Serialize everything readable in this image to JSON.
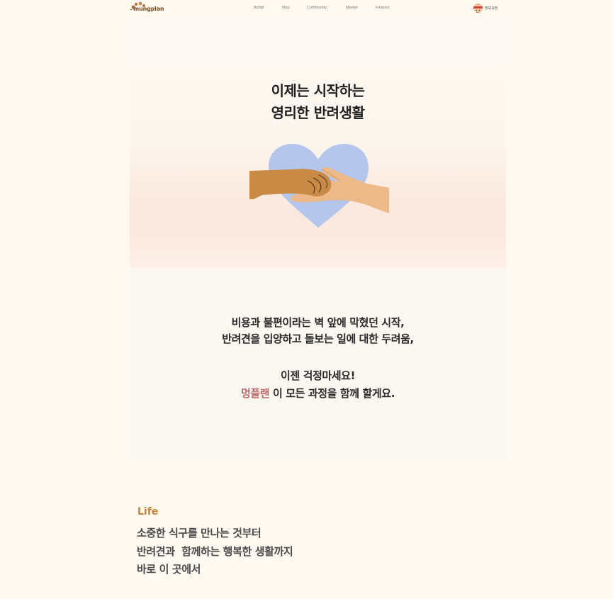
{
  "header": {
    "logo_text": "mungplan",
    "nav": [
      {
        "label": "Adopt"
      },
      {
        "label": "Map"
      },
      {
        "label": "Community"
      },
      {
        "label": "Market"
      },
      {
        "label": "Finance"
      }
    ],
    "user_name": "정보요정"
  },
  "hero": {
    "title_line1": "이제는 시작하는",
    "title_line2": "영리한 반려생활",
    "illustration_icon": "dog-paw-and-human-hand-on-heart-icon"
  },
  "message": {
    "line1": "비용과 불편이라는 벽 앞에 막혔던 시작,",
    "line2": "반려견을 입양하고 돌보는 일에 대한 두려움,",
    "line3": "이젠 걱정마세요!",
    "brand": "멍플랜",
    "line4_rest": " 이 모든 과정을 함께 할게요."
  },
  "life": {
    "label": "Life",
    "line1": "소중한 식구를 만나는 것부터",
    "line2": "반려견과  함께하는 행복한 생활까지",
    "line3": "바로 이 곳에서"
  },
  "colors": {
    "background": "#fefaf2",
    "brand_accent": "#b86a6e",
    "life_accent": "#c7863c",
    "heart": "#b4c6ec"
  }
}
